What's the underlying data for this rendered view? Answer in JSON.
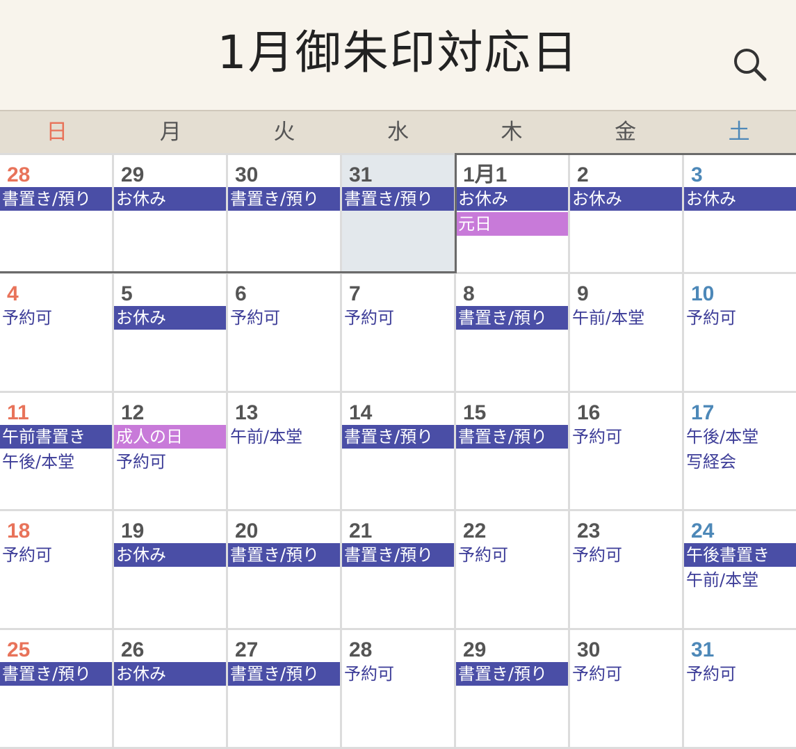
{
  "header": {
    "title": "1月御朱印対応日"
  },
  "weekdays": [
    "日",
    "月",
    "火",
    "水",
    "木",
    "金",
    "土"
  ],
  "weeks": [
    [
      {
        "day": "28",
        "type": "sun",
        "events": [
          {
            "text": "書置き/預り",
            "style": "closed"
          }
        ]
      },
      {
        "day": "29",
        "type": "",
        "events": [
          {
            "text": "お休み",
            "style": "closed"
          }
        ]
      },
      {
        "day": "30",
        "type": "",
        "events": [
          {
            "text": "書置き/預り",
            "style": "closed"
          }
        ]
      },
      {
        "day": "31",
        "type": "",
        "today": true,
        "events": [
          {
            "text": "書置き/預り",
            "style": "closed"
          }
        ]
      },
      {
        "day": "1月1",
        "type": "",
        "events": [
          {
            "text": "お休み",
            "style": "closed"
          },
          {
            "text": "元日",
            "style": "holiday"
          }
        ]
      },
      {
        "day": "2",
        "type": "",
        "events": [
          {
            "text": "お休み",
            "style": "closed"
          }
        ]
      },
      {
        "day": "3",
        "type": "sat",
        "events": [
          {
            "text": "お休み",
            "style": "closed"
          }
        ]
      }
    ],
    [
      {
        "day": "4",
        "type": "sun",
        "events": [
          {
            "text": "予約可",
            "style": "plain"
          }
        ]
      },
      {
        "day": "5",
        "type": "",
        "events": [
          {
            "text": "お休み",
            "style": "closed"
          }
        ]
      },
      {
        "day": "6",
        "type": "",
        "events": [
          {
            "text": "予約可",
            "style": "plain"
          }
        ]
      },
      {
        "day": "7",
        "type": "",
        "events": [
          {
            "text": "予約可",
            "style": "plain"
          }
        ]
      },
      {
        "day": "8",
        "type": "",
        "events": [
          {
            "text": "書置き/預り",
            "style": "closed"
          }
        ]
      },
      {
        "day": "9",
        "type": "",
        "events": [
          {
            "text": "午前/本堂",
            "style": "plain"
          }
        ]
      },
      {
        "day": "10",
        "type": "sat",
        "events": [
          {
            "text": "予約可",
            "style": "plain"
          }
        ]
      }
    ],
    [
      {
        "day": "11",
        "type": "sun",
        "events": [
          {
            "text": "午前書置き",
            "style": "closed"
          },
          {
            "text": "午後/本堂",
            "style": "plain"
          }
        ]
      },
      {
        "day": "12",
        "type": "",
        "events": [
          {
            "text": "成人の日",
            "style": "holiday"
          },
          {
            "text": "予約可",
            "style": "plain"
          }
        ]
      },
      {
        "day": "13",
        "type": "",
        "events": [
          {
            "text": "午前/本堂",
            "style": "plain"
          }
        ]
      },
      {
        "day": "14",
        "type": "",
        "events": [
          {
            "text": "書置き/預り",
            "style": "closed"
          }
        ]
      },
      {
        "day": "15",
        "type": "",
        "events": [
          {
            "text": "書置き/預り",
            "style": "closed"
          }
        ]
      },
      {
        "day": "16",
        "type": "",
        "events": [
          {
            "text": "予約可",
            "style": "plain"
          }
        ]
      },
      {
        "day": "17",
        "type": "sat",
        "events": [
          {
            "text": "午後/本堂",
            "style": "plain"
          },
          {
            "text": "写経会",
            "style": "plain"
          }
        ]
      }
    ],
    [
      {
        "day": "18",
        "type": "sun",
        "events": [
          {
            "text": "予約可",
            "style": "plain"
          }
        ]
      },
      {
        "day": "19",
        "type": "",
        "events": [
          {
            "text": "お休み",
            "style": "closed"
          }
        ]
      },
      {
        "day": "20",
        "type": "",
        "events": [
          {
            "text": "書置き/預り",
            "style": "closed"
          }
        ]
      },
      {
        "day": "21",
        "type": "",
        "events": [
          {
            "text": "書置き/預り",
            "style": "closed"
          }
        ]
      },
      {
        "day": "22",
        "type": "",
        "events": [
          {
            "text": "予約可",
            "style": "plain"
          }
        ]
      },
      {
        "day": "23",
        "type": "",
        "events": [
          {
            "text": "予約可",
            "style": "plain"
          }
        ]
      },
      {
        "day": "24",
        "type": "sat",
        "events": [
          {
            "text": "午後書置き",
            "style": "closed"
          },
          {
            "text": "午前/本堂",
            "style": "plain"
          }
        ]
      }
    ],
    [
      {
        "day": "25",
        "type": "sun",
        "events": [
          {
            "text": "書置き/預り",
            "style": "closed"
          }
        ]
      },
      {
        "day": "26",
        "type": "",
        "events": [
          {
            "text": "お休み",
            "style": "closed"
          }
        ]
      },
      {
        "day": "27",
        "type": "",
        "events": [
          {
            "text": "書置き/預り",
            "style": "closed"
          }
        ]
      },
      {
        "day": "28",
        "type": "",
        "events": [
          {
            "text": "予約可",
            "style": "plain"
          }
        ]
      },
      {
        "day": "29",
        "type": "",
        "events": [
          {
            "text": "書置き/預り",
            "style": "closed"
          }
        ]
      },
      {
        "day": "30",
        "type": "",
        "events": [
          {
            "text": "予約可",
            "style": "plain"
          }
        ]
      },
      {
        "day": "31",
        "type": "sat",
        "events": [
          {
            "text": "予約可",
            "style": "plain"
          }
        ]
      }
    ]
  ],
  "icons": {
    "search": "search-icon"
  },
  "colors": {
    "sunday": "#e8735a",
    "saturday": "#4d88b8",
    "closed_bar": "#4a4ea6",
    "holiday_bar": "#c87ad9",
    "today_bg": "#e3e8ec"
  }
}
